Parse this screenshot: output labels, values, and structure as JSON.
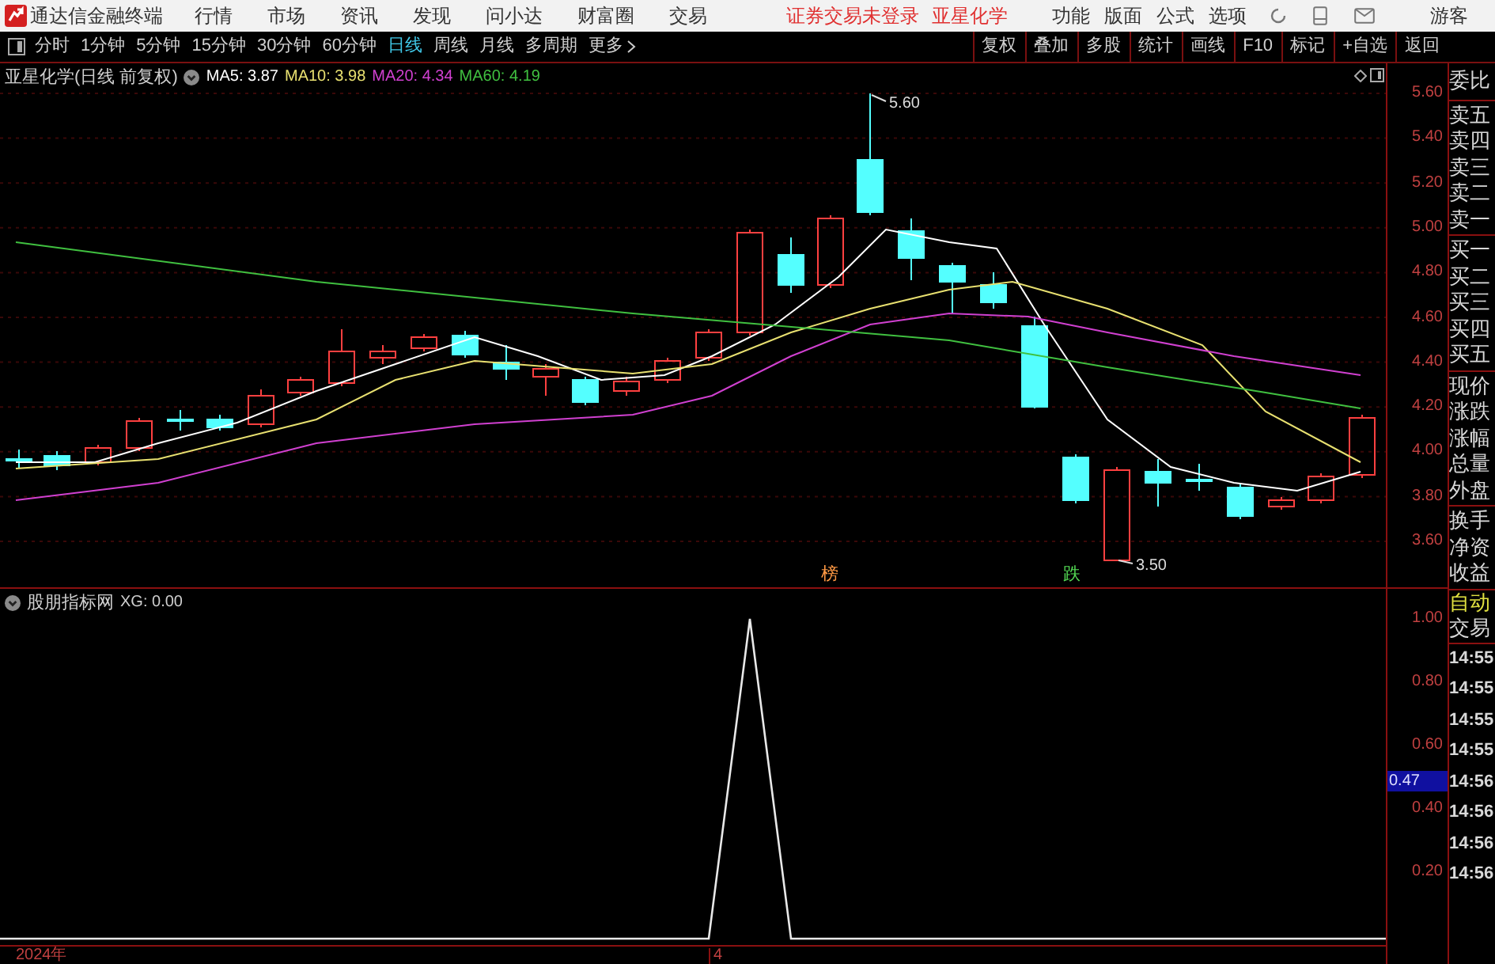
{
  "app": {
    "title": "通达信金融终端"
  },
  "menu": [
    "行情",
    "市场",
    "资讯",
    "发现",
    "问小达",
    "财富圈",
    "交易"
  ],
  "status_text": "证券交易未登录",
  "stock_name": "亚星化学",
  "top_menu": [
    "功能",
    "版面",
    "公式",
    "选项"
  ],
  "user": "游客",
  "period_tabs": [
    {
      "label": "分时",
      "selected": false
    },
    {
      "label": "1分钟",
      "selected": false
    },
    {
      "label": "5分钟",
      "selected": false
    },
    {
      "label": "15分钟",
      "selected": false
    },
    {
      "label": "30分钟",
      "selected": false
    },
    {
      "label": "60分钟",
      "selected": false
    },
    {
      "label": "日线",
      "selected": true
    },
    {
      "label": "周线",
      "selected": false
    },
    {
      "label": "月线",
      "selected": false
    },
    {
      "label": "多周期",
      "selected": false
    },
    {
      "label": "更多",
      "selected": false
    }
  ],
  "tool_buttons": [
    "复权",
    "叠加",
    "多股",
    "统计",
    "画线",
    "F10",
    "标记",
    "+自选",
    "返回"
  ],
  "main_chart": {
    "legend": "亚星化学(日线 前复权)",
    "indicators": [
      {
        "label": "MA5: 3.87",
        "color": "#ffffff"
      },
      {
        "label": "MA10: 3.98",
        "color": "#e8e070"
      },
      {
        "label": "MA20: 4.34",
        "color": "#d040d0"
      },
      {
        "label": "MA60: 4.19",
        "color": "#40c040"
      }
    ],
    "high_label": "5.60",
    "low_label": "3.50",
    "price_axis": [
      "5.60",
      "5.40",
      "5.20",
      "5.00",
      "4.80",
      "4.60",
      "4.40",
      "4.20",
      "4.00",
      "3.80",
      "3.60"
    ],
    "markers": [
      {
        "text": "榜",
        "color": "#ff9944"
      },
      {
        "text": "跌",
        "color": "#55dd55"
      }
    ]
  },
  "indicator_panel": {
    "legend": "股朋指标网",
    "reading": "XG: 0.00",
    "axis": [
      "1.00",
      "0.80",
      "0.60",
      "0.40",
      "0.20"
    ],
    "cursor_value": "0.47"
  },
  "date_axis": [
    "2024年",
    "4"
  ],
  "quote_panel": {
    "groups": [
      [
        "委比"
      ],
      [
        "卖五",
        "卖四",
        "卖三",
        "卖二",
        "卖一"
      ],
      [
        "买一",
        "买二",
        "买三",
        "买四",
        "买五"
      ],
      [
        "现价",
        "涨跌",
        "涨幅",
        "总量",
        "外盘"
      ],
      [
        "换手",
        "净资",
        "收益"
      ]
    ],
    "auto_label": "自动",
    "trade_label": "交易",
    "times": [
      "14:55",
      "14:55",
      "14:55",
      "14:55",
      "14:56",
      "14:56",
      "14:56",
      "14:56"
    ]
  }
}
